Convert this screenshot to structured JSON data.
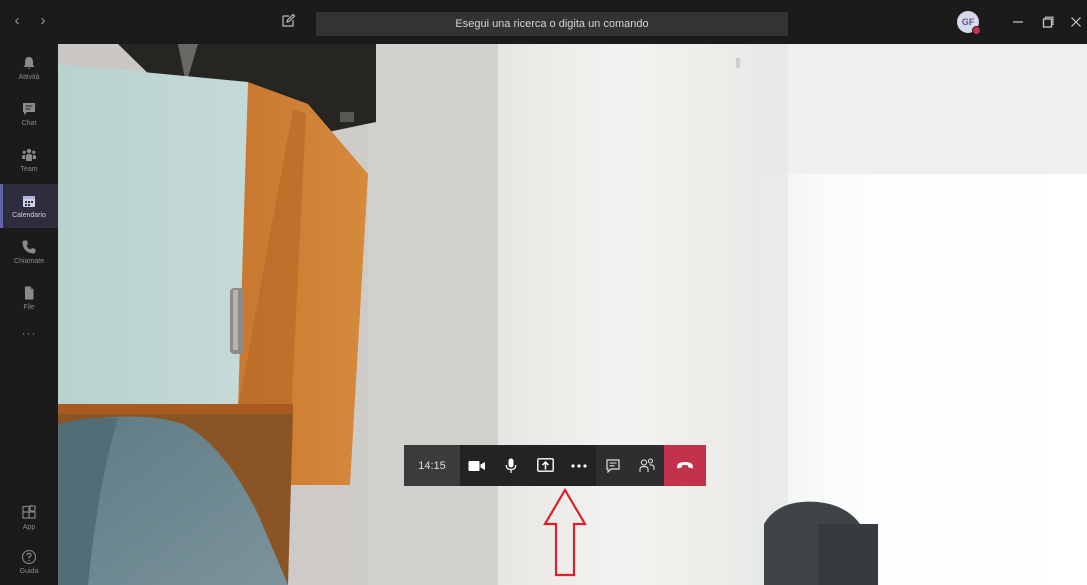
{
  "titlebar": {
    "search_placeholder": "Esegui una ricerca o digita un comando",
    "avatar_initials": "GF",
    "nav_back": "‹",
    "nav_forward": "›"
  },
  "rail": {
    "items": [
      {
        "label": "Attività",
        "icon": "bell-icon"
      },
      {
        "label": "Chat",
        "icon": "chat-icon"
      },
      {
        "label": "Team",
        "icon": "team-icon"
      },
      {
        "label": "Calendario",
        "icon": "calendar-icon",
        "active": true
      },
      {
        "label": "Chiamate",
        "icon": "phone-icon"
      },
      {
        "label": "File",
        "icon": "file-icon"
      }
    ],
    "more": "···",
    "bottom": [
      {
        "label": "App",
        "icon": "apps-icon"
      },
      {
        "label": "Guida",
        "icon": "help-icon"
      }
    ]
  },
  "callbar": {
    "time": "14:15"
  },
  "colors": {
    "accent": "#6264a7",
    "hangup": "#c4314b",
    "annotation_arrow": "#d9222a"
  }
}
